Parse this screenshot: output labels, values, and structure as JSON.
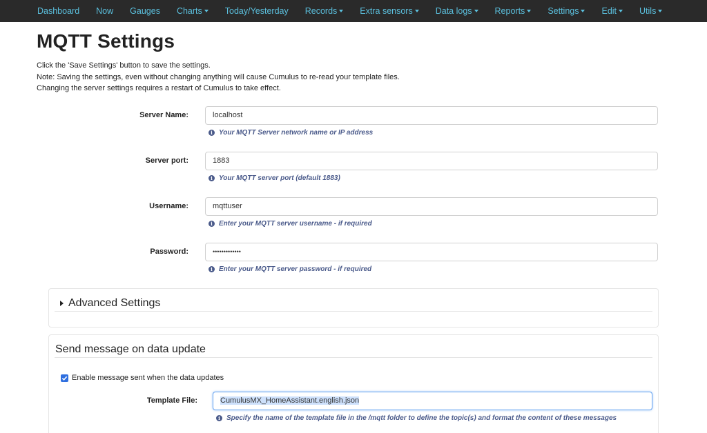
{
  "nav": {
    "items": [
      {
        "label": "Dashboard",
        "dropdown": false
      },
      {
        "label": "Now",
        "dropdown": false
      },
      {
        "label": "Gauges",
        "dropdown": false
      },
      {
        "label": "Charts",
        "dropdown": true
      },
      {
        "label": "Today/Yesterday",
        "dropdown": false
      },
      {
        "label": "Records",
        "dropdown": true
      },
      {
        "label": "Extra sensors",
        "dropdown": true
      },
      {
        "label": "Data logs",
        "dropdown": true
      },
      {
        "label": "Reports",
        "dropdown": true
      },
      {
        "label": "Settings",
        "dropdown": true
      },
      {
        "label": "Edit",
        "dropdown": true
      },
      {
        "label": "Utils",
        "dropdown": true
      }
    ]
  },
  "page": {
    "title": "MQTT Settings",
    "intro": [
      "Click the 'Save Settings' button to save the settings.",
      "Note: Saving the settings, even without changing anything will cause Cumulus to re-read your template files.",
      "Changing the server settings requires a restart of Cumulus to take effect."
    ]
  },
  "form": {
    "server_name": {
      "label": "Server Name:",
      "value": "localhost",
      "help": "Your MQTT Server network name or IP address"
    },
    "server_port": {
      "label": "Server port:",
      "value": "1883",
      "help": "Your MQTT server port (default 1883)"
    },
    "username": {
      "label": "Username:",
      "value": "mqttuser",
      "help": "Enter your MQTT server username - if required"
    },
    "password": {
      "label": "Password:",
      "value": "•••••••••••••",
      "help": "Enter your MQTT server password - if required"
    }
  },
  "advanced": {
    "title": "Advanced Settings"
  },
  "update": {
    "title": "Send message on data update",
    "enable_label": "Enable message sent when the data updates",
    "enabled": true,
    "template_label": "Template File:",
    "template_value": "CumulusMX_HomeAssistant.english.json",
    "template_help": "Specify the name of the template file in the /mqtt folder to define the topic(s) and format the content of these messages"
  },
  "colors": {
    "nav_bg": "#2a2a2a",
    "nav_link": "#5bc0de",
    "help_text": "#4a5a8a",
    "checkbox": "#2f6fdf"
  }
}
